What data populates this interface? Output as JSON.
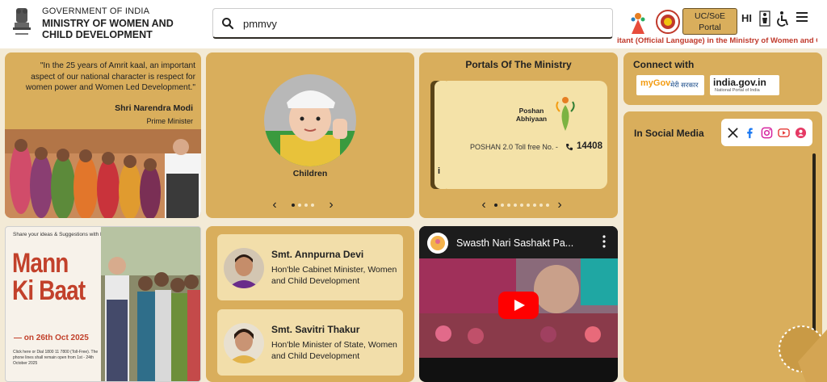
{
  "header": {
    "gov_line": "GOVERNMENT OF INDIA",
    "ministry": "MINISTRY OF WOMEN AND CHILD DEVELOPMENT",
    "search_value": "pmmvy",
    "portal_button": "UC/SoE Portal",
    "lang_button": "HI",
    "ticker": "itant (Official Language) in the Ministry of Women and C"
  },
  "quote": {
    "text": "\"In the 25 years of Amrit kaal, an important aspect of our national character is respect for women power and Women Led Development.\"",
    "name": "Shri Narendra Modi",
    "role": "Prime Minister"
  },
  "children": {
    "label": "Children",
    "dots": 4,
    "active_dot": 0
  },
  "portals": {
    "title": "Portals Of The Ministry",
    "logo_text": "Poshan Abhiyaan",
    "toll_label": "POSHAN 2.0 Toll free No. -",
    "toll_number": "14408",
    "peek_text": "ity",
    "dots": 9,
    "active_dot": 0
  },
  "connect": {
    "title": "Connect with",
    "mygov_text": "मेरी सरकार",
    "mygov_brand": "myGov",
    "indiagov_brand": "india.gov.in",
    "indiagov_sub": "National Portal of India"
  },
  "social": {
    "title": "In Social Media",
    "icons": [
      "x-icon",
      "facebook-icon",
      "instagram-icon",
      "youtube-icon",
      "koo-icon"
    ]
  },
  "mkb": {
    "share": "Share your ideas & Suggestions with PM for",
    "title_line1": "Mann",
    "title_line2": "Ki Baat",
    "date": "— on 26th Oct 2025",
    "small_text": "Click here or Dial 1800 11 7800 (Toll-Free). The phone lines shall remain open from 1st - 24th October 2025"
  },
  "ministers": [
    {
      "name": "Smt. Annpurna Devi",
      "role": "Hon'ble Cabinet Minister, Women and Child Development"
    },
    {
      "name": "Smt. Savitri Thakur",
      "role": "Hon'ble Minister of State, Women and Child Development"
    }
  ],
  "video": {
    "title": "Swasth Nari Sashakt Pa..."
  },
  "colors": {
    "card": "#d9ae5c",
    "ticker": "#c0392b",
    "minister_bg": "#f2deaa",
    "youtube_red": "#ff0000"
  }
}
